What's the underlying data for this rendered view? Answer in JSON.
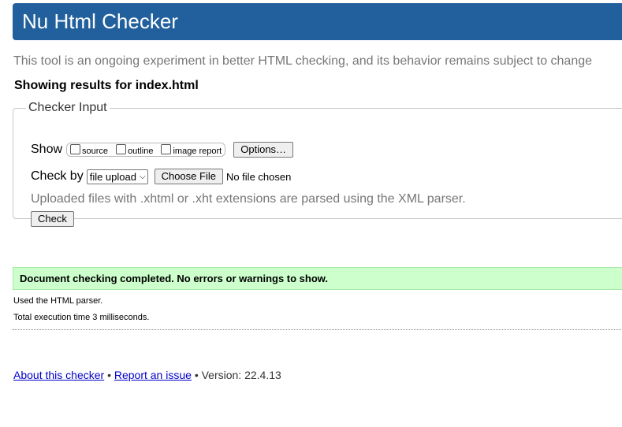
{
  "header": {
    "title": "Nu Html Checker"
  },
  "tagline": "This tool is an ongoing experiment in better HTML checking, and its behavior remains subject to change",
  "showing": "Showing results for index.html",
  "checker_input": {
    "legend": "Checker Input",
    "show_label": "Show",
    "checkboxes": [
      {
        "label": "source",
        "checked": false
      },
      {
        "label": "outline",
        "checked": false
      },
      {
        "label": "image report",
        "checked": false
      }
    ],
    "options_button": "Options…",
    "check_by_label": "Check by",
    "check_by_value": "file upload",
    "choose_file_button": "Choose File",
    "no_file_text": "No file chosen",
    "note": "Uploaded files with .xhtml or .xht extensions are parsed using the XML parser.",
    "check_button": "Check"
  },
  "results": {
    "success_message": "Document checking completed. No errors or warnings to show.",
    "parser_line": "Used the HTML parser.",
    "time_line": "Total execution time 3 milliseconds.",
    "success_color": "#ccffcc"
  },
  "footer": {
    "about_link": "About this checker",
    "separator": "•",
    "report_link": "Report an issue",
    "version": "Version: 22.4.13"
  },
  "colors": {
    "header_bg": "#21609c",
    "link": "#0000cc"
  }
}
